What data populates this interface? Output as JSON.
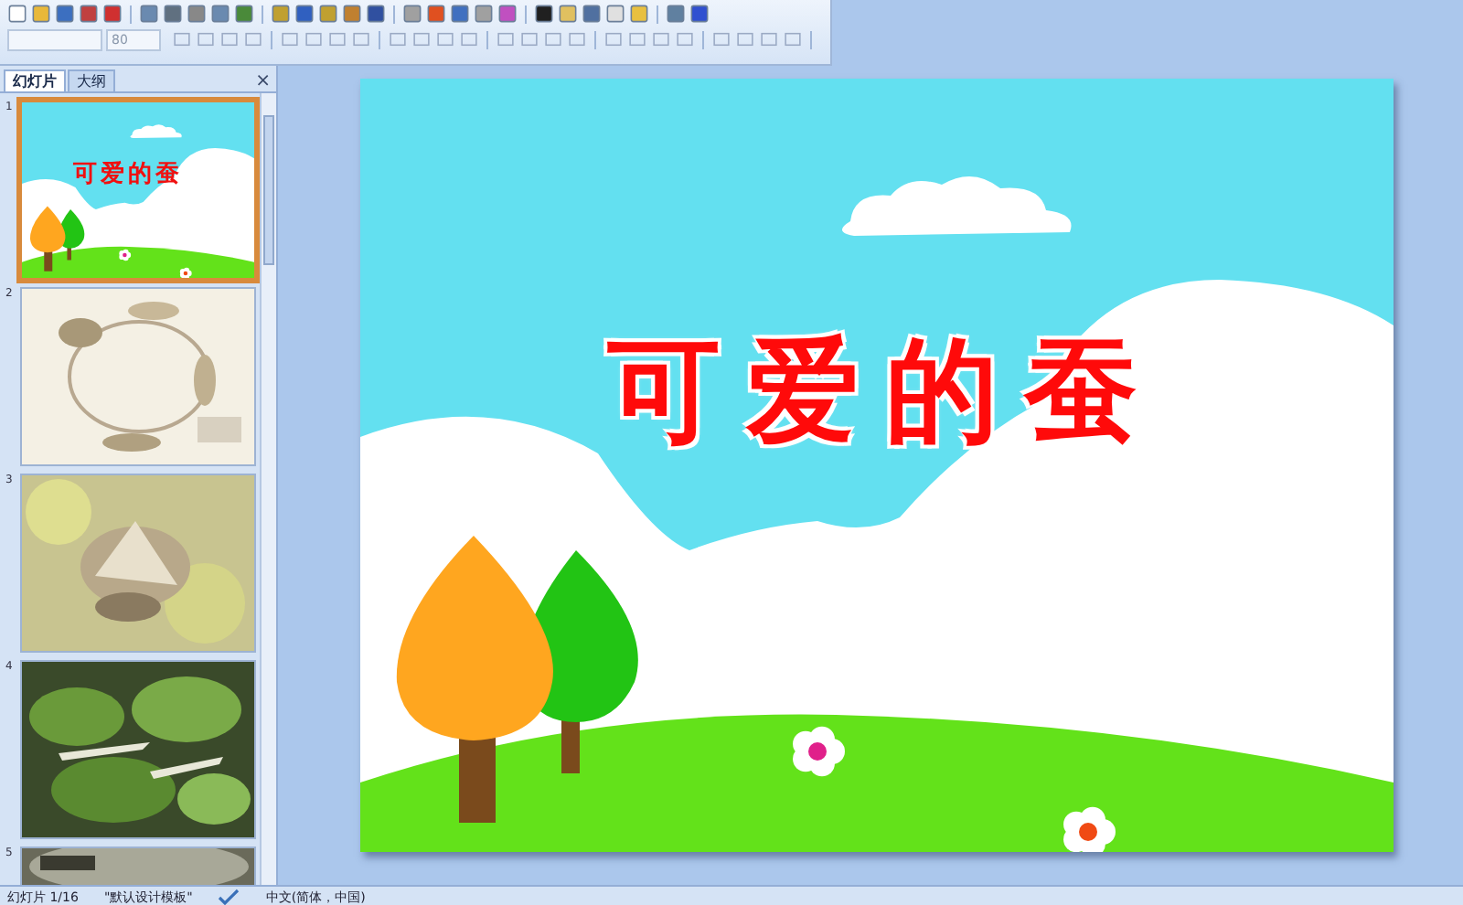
{
  "toolbar": {
    "font_size": "80"
  },
  "panel": {
    "tabs": [
      {
        "label": "幻灯片",
        "selected": true
      },
      {
        "label": "大纲",
        "selected": false
      }
    ],
    "close": "×"
  },
  "slides": [
    {
      "number": "1",
      "selected": true,
      "kind": "title",
      "title": "可爱的蚕"
    },
    {
      "number": "2",
      "selected": false,
      "kind": "picture"
    },
    {
      "number": "3",
      "selected": false,
      "kind": "picture"
    },
    {
      "number": "4",
      "selected": false,
      "kind": "picture"
    },
    {
      "number": "5",
      "selected": false,
      "kind": "picture"
    }
  ],
  "slide": {
    "title": "可爱的蚕"
  },
  "status_bar": {
    "position": "幻灯片 1/16",
    "theme": "\"默认设计模板\"",
    "language": "中文(简体，中国)"
  }
}
